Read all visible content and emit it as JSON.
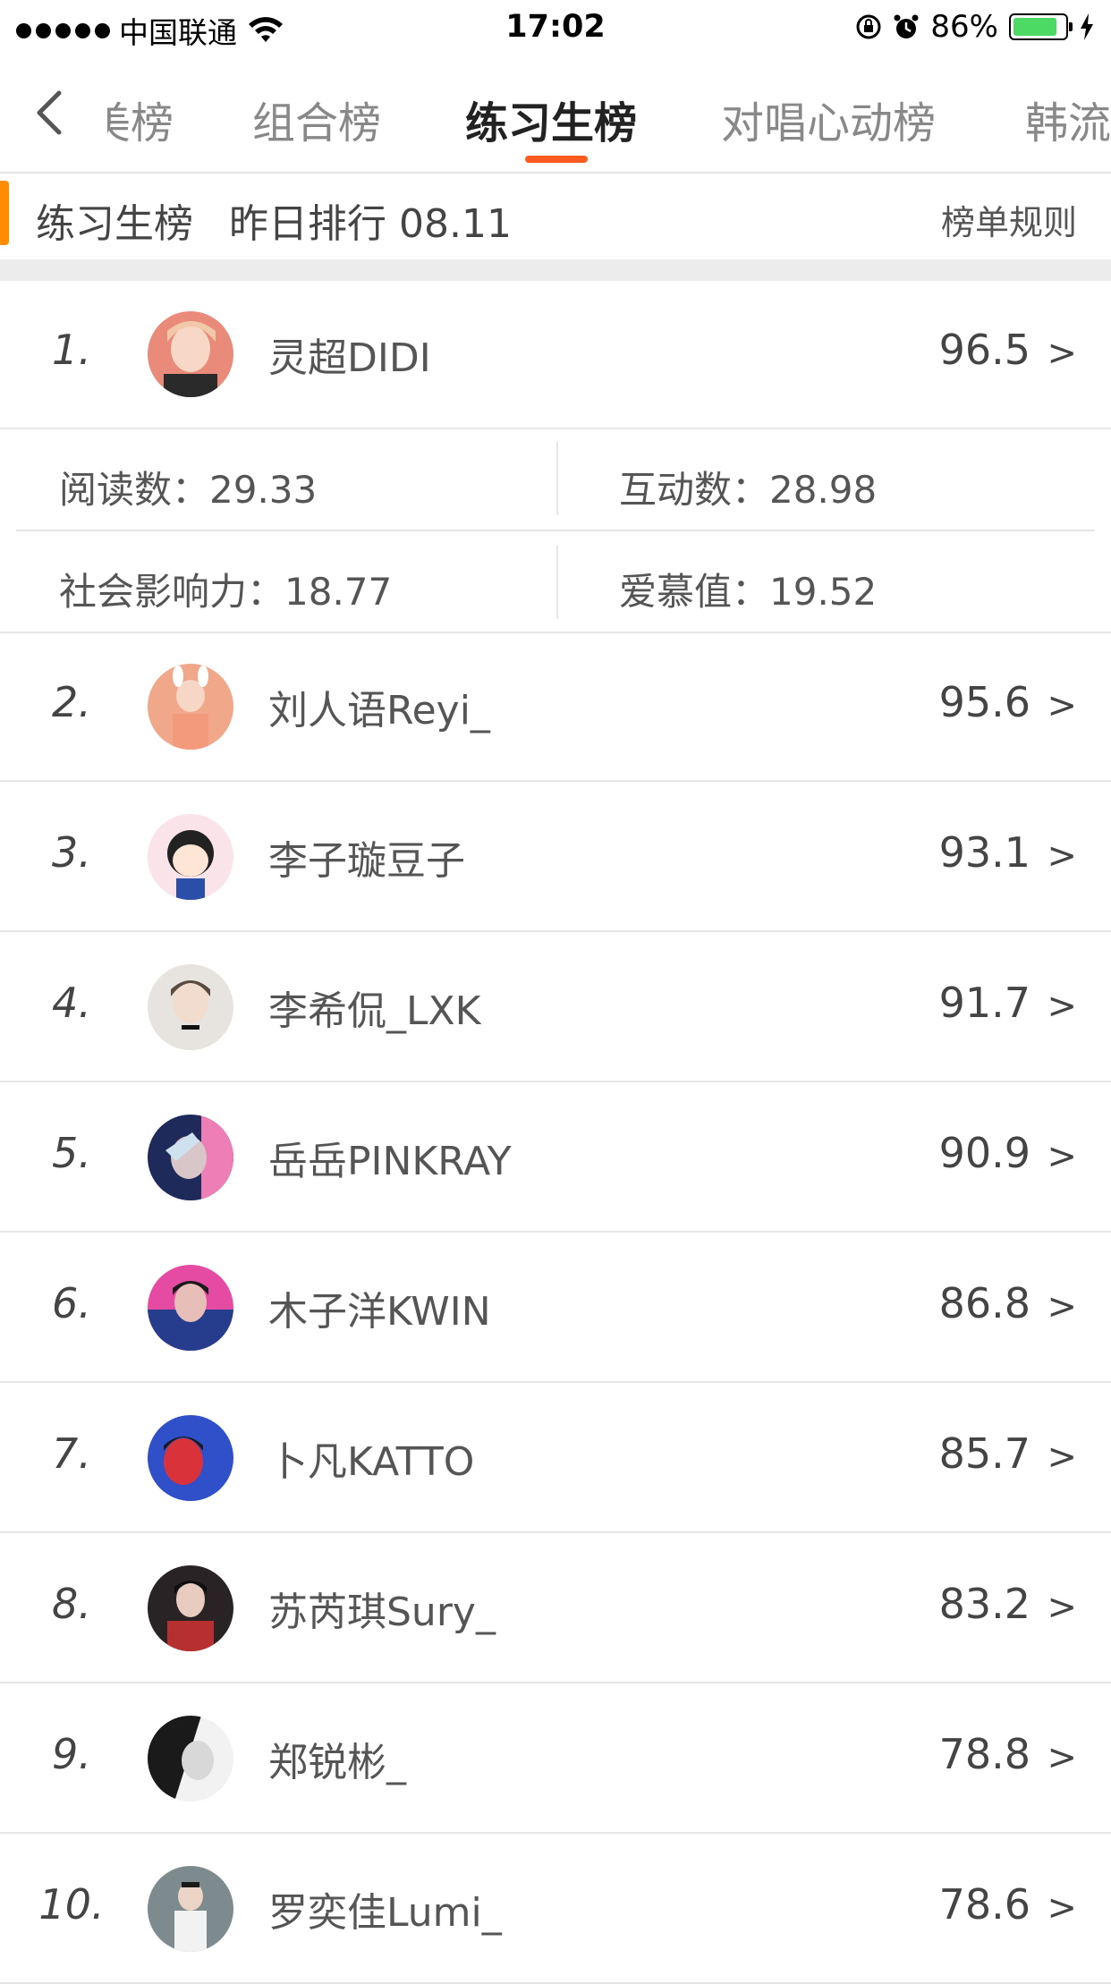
{
  "status_bar": {
    "carrier": "中国联通",
    "time": "17:02",
    "battery_percent": "86%",
    "battery_level": 0.86
  },
  "tabs": [
    {
      "label": "美榜"
    },
    {
      "label": "组合榜"
    },
    {
      "label": "练习生榜"
    },
    {
      "label": "对唱心动榜"
    },
    {
      "label": "韩流"
    }
  ],
  "active_tab_index": 2,
  "section": {
    "title": "练习生榜",
    "date": "昨日排行 08.11",
    "rules_link": "榜单规则"
  },
  "colors": {
    "accent_orange": "#ff8c00",
    "tab_indicator": "#ff5a1f",
    "battery_green": "#4cd964"
  },
  "featured_stats": {
    "read": "阅读数：29.33",
    "interact": "互动数：28.98",
    "influence": "社会影响力：18.77",
    "adore": "爱慕值：19.52"
  },
  "rankings": [
    {
      "rank": "1.",
      "name": "灵超DIDI",
      "score": "96.5",
      "chevron": ">"
    },
    {
      "rank": "2.",
      "name": "刘人语Reyi_",
      "score": "95.6",
      "chevron": ">"
    },
    {
      "rank": "3.",
      "name": "李子璇豆子",
      "score": "93.1",
      "chevron": ">"
    },
    {
      "rank": "4.",
      "name": "李希侃_LXK",
      "score": "91.7",
      "chevron": ">"
    },
    {
      "rank": "5.",
      "name": "岳岳PINKRAY",
      "score": "90.9",
      "chevron": ">"
    },
    {
      "rank": "6.",
      "name": "木子洋KWIN",
      "score": "86.8",
      "chevron": ">"
    },
    {
      "rank": "7.",
      "name": "卜凡KATTO",
      "score": "85.7",
      "chevron": ">"
    },
    {
      "rank": "8.",
      "name": "苏芮琪Sury_",
      "score": "83.2",
      "chevron": ">"
    },
    {
      "rank": "9.",
      "name": "郑锐彬_",
      "score": "78.8",
      "chevron": ">"
    },
    {
      "rank": "10.",
      "name": "罗奕佳Lumi_",
      "score": "78.6",
      "chevron": ">"
    }
  ]
}
